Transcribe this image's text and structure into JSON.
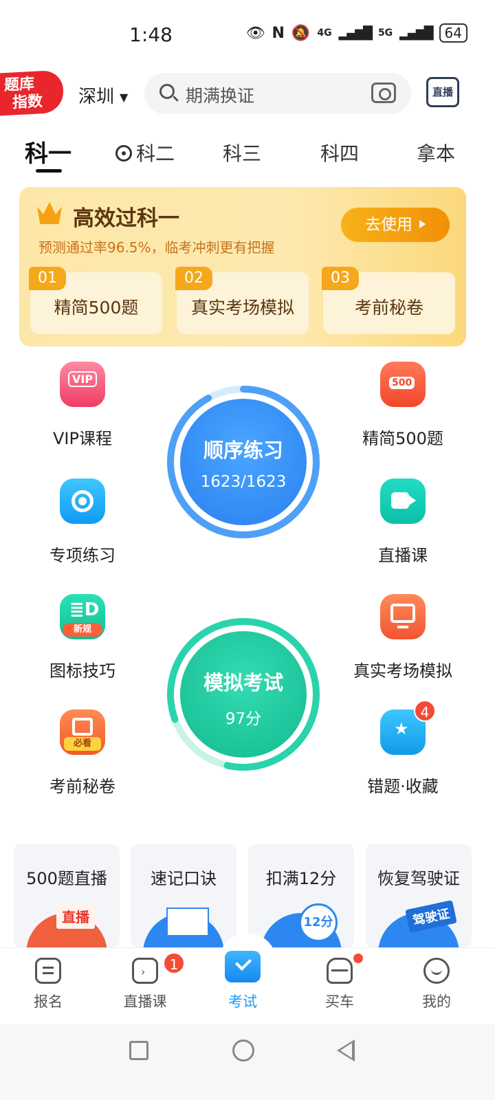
{
  "status_bar": {
    "time": "1:48",
    "network1": "4G",
    "network2": "5G",
    "battery": "64"
  },
  "header": {
    "logo_line1": "题库",
    "logo_line2": "指数",
    "city": "深圳",
    "search_placeholder": "期满换证",
    "live_label": "直播"
  },
  "subject_tabs": [
    "科一",
    "科二",
    "科三",
    "科四",
    "拿本"
  ],
  "promo": {
    "title": "高效过科一",
    "subtitle": "预测通过率96.5%，临考冲刺更有把握",
    "button": "去使用",
    "features": [
      {
        "num": "01",
        "label": "精简500题"
      },
      {
        "num": "02",
        "label": "真实考场模拟"
      },
      {
        "num": "03",
        "label": "考前秘卷"
      }
    ]
  },
  "grid": {
    "vip": "VIP课程",
    "vip_icon_text": "VIP",
    "special": "专项练习",
    "signs": "图标技巧",
    "signs_badge": "新规",
    "secret": "考前秘卷",
    "secret_badge": "必看",
    "jingjian": "精简500题",
    "jingjian_icon_text": "500",
    "live": "直播课",
    "real_exam": "真实考场模拟",
    "wrong": "错题·收藏",
    "wrong_badge": "4"
  },
  "practice": {
    "title": "顺序练习",
    "progress": "1623/1623",
    "progress_fraction": 1.0,
    "color": "#2f8cf2"
  },
  "exam": {
    "title": "模拟考试",
    "score": "97分",
    "color": "#1cc9a3"
  },
  "cards": [
    {
      "title": "500题直播",
      "tag": "直播"
    },
    {
      "title": "速记口诀",
      "tag": ""
    },
    {
      "title": "扣满12分",
      "tag": "12分"
    },
    {
      "title": "恢复驾驶证",
      "tag": "驾驶证"
    }
  ],
  "nav": {
    "items": [
      {
        "label": "报名",
        "icon": "signup-icon"
      },
      {
        "label": "直播课",
        "icon": "tv-icon",
        "badge": "1"
      },
      {
        "label": "考试",
        "icon": "exam-folder-icon"
      },
      {
        "label": "买车",
        "icon": "car-icon"
      },
      {
        "label": "我的",
        "icon": "smile-icon"
      }
    ]
  }
}
